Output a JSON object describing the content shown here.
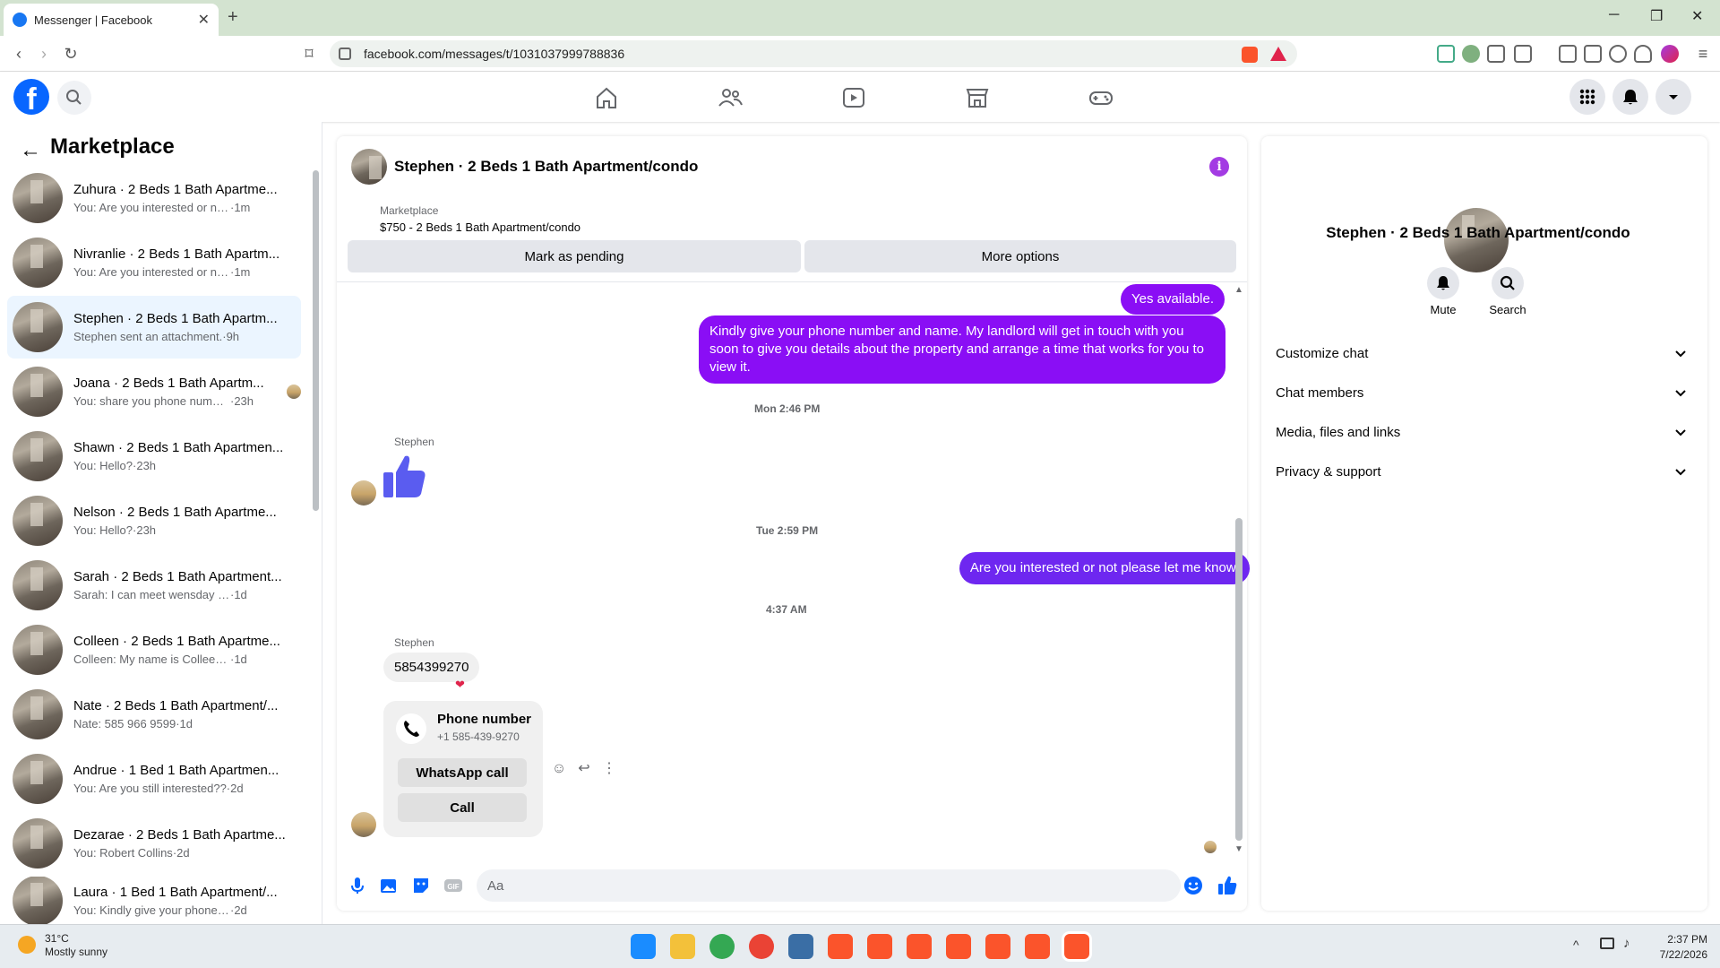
{
  "browser": {
    "tab_title": "Messenger | Facebook",
    "url": "facebook.com/messages/t/1031037999788836"
  },
  "left_panel": {
    "title": "Marketplace",
    "conversations": [
      {
        "name": "Zuhura · 2 Beds 1 Bath Apartme...",
        "preview": "You: Are you interested or not ple...",
        "time": "·1m"
      },
      {
        "name": "Nivranlie · 2 Beds 1 Bath Apartm...",
        "preview": "You: Are you interested or not ple...",
        "time": "·1m"
      },
      {
        "name": "Stephen · 2 Beds 1 Bath Apartm...",
        "preview": "Stephen sent an attachment.",
        "time": "·9h"
      },
      {
        "name": "Joana · 2 Beds 1 Bath Apartm...",
        "preview": "You: share you phone number ...",
        "time": "·23h"
      },
      {
        "name": "Shawn · 2 Beds 1 Bath Apartmen...",
        "preview": "You: Hello?",
        "time": "·23h"
      },
      {
        "name": "Nelson · 2 Beds 1 Bath Apartme...",
        "preview": "You: Hello?",
        "time": "·23h"
      },
      {
        "name": "Sarah · 2 Beds 1 Bath Apartment...",
        "preview": "Sarah: I can meet wensday mornin...",
        "time": "·1d"
      },
      {
        "name": "Colleen · 2 Beds 1 Bath Apartme...",
        "preview": "Colleen: My name is Colleen Sherid...",
        "time": "·1d"
      },
      {
        "name": "Nate · 2 Beds 1 Bath Apartment/...",
        "preview": "Nate: 585 966 9599",
        "time": "·1d"
      },
      {
        "name": "Andrue · 1 Bed 1 Bath Apartmen...",
        "preview": "You: Are you still interested??",
        "time": "·2d"
      },
      {
        "name": "Dezarae · 2 Beds 1 Bath Apartme...",
        "preview": "You: Robert Collins",
        "time": "·2d"
      },
      {
        "name": "Laura · 1 Bed 1 Bath Apartment/...",
        "preview": "You: Kindly give your phone numbe...",
        "time": "·2d"
      }
    ]
  },
  "chat": {
    "title": "Stephen · 2 Beds 1 Bath Apartment/condo",
    "marketplace_label": "Marketplace",
    "listing": "$750 - 2 Beds 1 Bath Apartment/condo",
    "mark_pending": "Mark as pending",
    "more_options": "More options",
    "messages": {
      "m1": "Yes available.",
      "m2": "Kindly give your phone number and name. My landlord will get in touch with you soon to give you details about the property and arrange a time that works for you to view it.",
      "ts1": "Mon 2:46 PM",
      "sender1": "Stephen",
      "ts2": "Tue 2:59 PM",
      "m3": "Are you interested or not please let me know.",
      "ts3": "4:37 AM",
      "sender2": "Stephen",
      "m4": "5854399270"
    },
    "phone_card": {
      "title": "Phone number",
      "number": "+1 585-439-9270",
      "whatsapp": "WhatsApp call",
      "call": "Call"
    },
    "composer_placeholder": "Aa"
  },
  "right_panel": {
    "name": "Stephen · 2 Beds 1 Bath Apartment/condo",
    "mute": "Mute",
    "search": "Search",
    "sections": [
      "Customize chat",
      "Chat members",
      "Media, files and links",
      "Privacy & support"
    ]
  },
  "taskbar": {
    "temp": "31°C",
    "weather": "Mostly sunny",
    "time": "2:37 PM",
    "date": "7/22/2026"
  },
  "colors": {
    "accent": "#8a0ef5",
    "fb_blue": "#0866ff"
  }
}
